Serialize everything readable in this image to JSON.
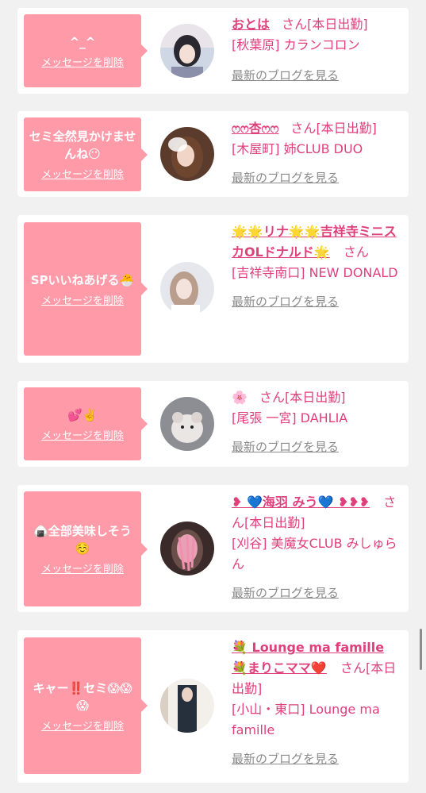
{
  "common": {
    "delete_label": "メッセージを削除",
    "blog_label": "最新のブログを見る"
  },
  "items": [
    {
      "message": "^_^",
      "name": "おとは",
      "san": "さん",
      "status": "[本日出勤]",
      "shop": "[秋葉原] カランコロン"
    },
    {
      "message": "セミ全然見かけませんね😶",
      "name": "ෆෆ杏ෆෆ",
      "san": "さん",
      "status": "[本日出勤]",
      "shop": "[木屋町] 姉CLUB DUO"
    },
    {
      "message": "SPいいねあげる🐣",
      "name": "🌟🌟リナ🌟🌟吉祥寺ミニスカOLドナルド🌟",
      "san": "さん",
      "status": "",
      "shop": "[吉祥寺南口] NEW DONALD"
    },
    {
      "message": "💕✌️",
      "name": "🌸",
      "san": "さん",
      "status": "[本日出勤]",
      "shop": "[尾張 一宮] DAHLIA"
    },
    {
      "message": "🍙全部美味しそう☺️",
      "name": "❥ 💙海羽 みう💙 ❥❥❥",
      "san": "さん",
      "status": "[本日出勤]",
      "shop": "[刈谷] 美魔女CLUB みしゅらん"
    },
    {
      "message": "キャー‼️セミ😱😱😱",
      "name": "💐 Lounge ma famille💐まりこママ❤️",
      "san": "さん",
      "status": "[本日出勤]",
      "shop": "[小山・東口] Lounge ma famille"
    }
  ]
}
